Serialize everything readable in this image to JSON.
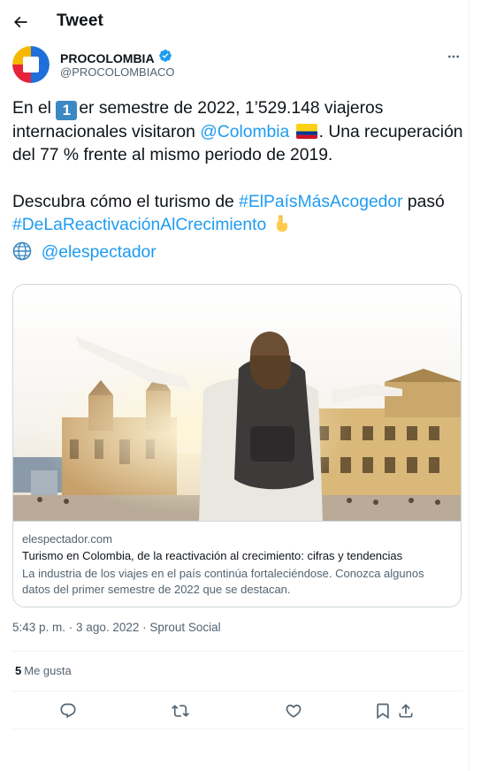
{
  "header": {
    "title": "Tweet",
    "back_icon": "arrow-left-icon"
  },
  "author": {
    "name": "PROCOLOMBIA",
    "handle": "@PROCOLOMBIACO",
    "verified_icon": "verified-badge-icon",
    "more_icon": "more-horizontal-icon",
    "avatar_colors": [
      "#1e6fd9",
      "#f5b800",
      "#e5233b",
      "#ffffff"
    ]
  },
  "tweet": {
    "p1_a": "En el ",
    "p1_badge": "1",
    "p1_b": "er semestre de 2022, 1’529.148 viajeros internacionales visitaron ",
    "p1_mention": "@Colombia",
    "p1_c": ". Una recuperación del 77 % frente al mismo periodo de 2019.",
    "p2_a": "Descubra cómo el turismo de ",
    "p2_tag1": "#ElPaísMásAcogedor",
    "p2_b": " pasó ",
    "p2_tag2": "#DeLaReactivaciónAlCrecimiento",
    "p3_mention": "@elespectador",
    "flag_icon": "colombia-flag-icon",
    "pointing_icon": "pointing-down-hand-icon",
    "globe_icon": "globe-icon"
  },
  "card": {
    "domain": "elespectador.com",
    "title": "Turismo en Colombia, de la reactivación al crecimiento: cifras y tendencias",
    "description": "La industria de los viajes en el país continúa fortaleciéndose. Conozca algunos datos del primer semestre de 2022 que se destacan."
  },
  "meta": {
    "time": "5:43 p. m.",
    "sep1": " · ",
    "date": "3 ago. 2022",
    "sep2": " · ",
    "source": "Sprout Social"
  },
  "stats": {
    "likes_count": "5",
    "likes_label": "Me gusta"
  },
  "actions": {
    "reply_icon": "reply-icon",
    "retweet_icon": "retweet-icon",
    "like_icon": "heart-icon",
    "bookmark_icon": "bookmark-icon",
    "share_icon": "share-icon"
  },
  "colors": {
    "accent": "#1d9bf0",
    "text": "#0f1419",
    "muted": "#536471",
    "border": "#cfd9de"
  }
}
